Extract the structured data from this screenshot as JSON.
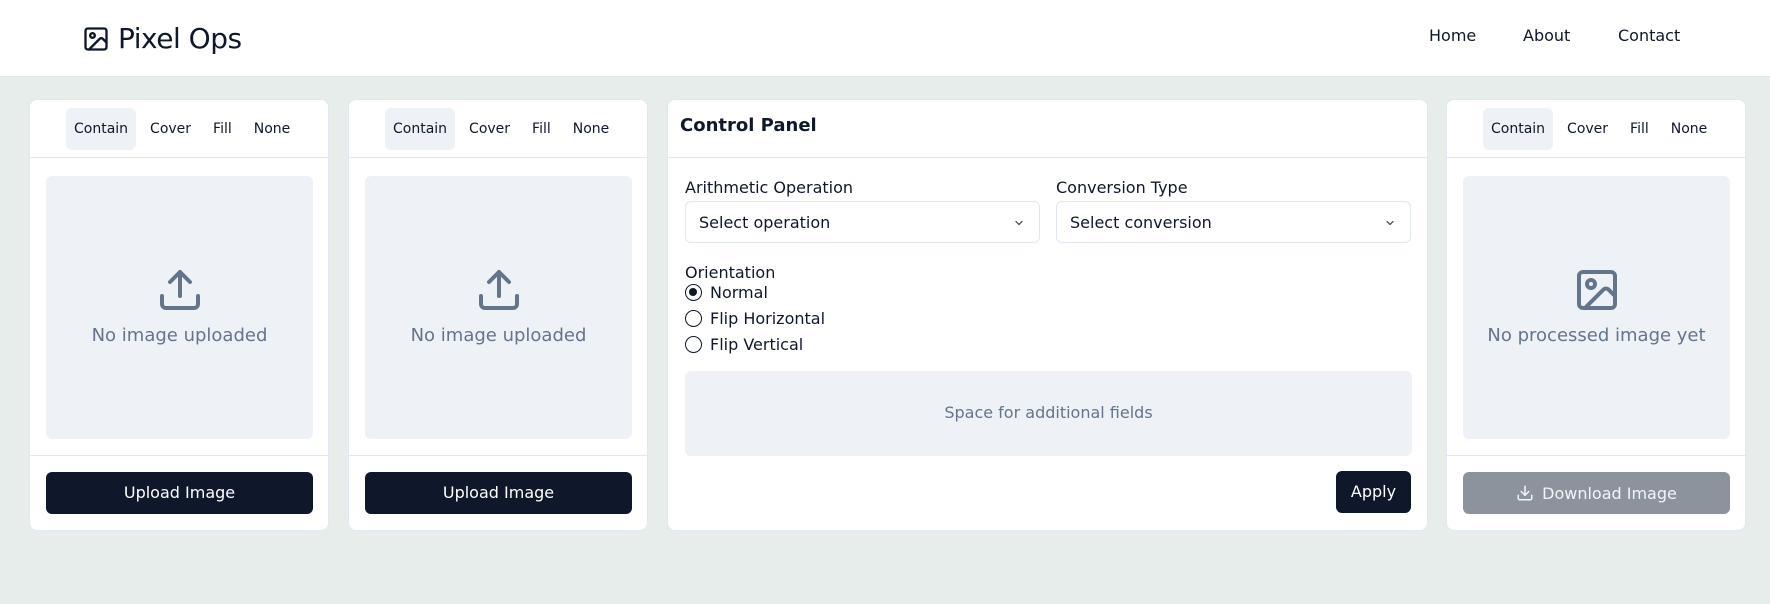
{
  "brand": {
    "name": "Pixel Ops",
    "icon": "image-icon"
  },
  "nav": {
    "links": [
      "Home",
      "About",
      "Contact"
    ]
  },
  "fit_tabs": [
    "Contain",
    "Cover",
    "Fill",
    "None"
  ],
  "input_panels": [
    {
      "active_tab": "Contain",
      "empty_text": "No image uploaded",
      "icon": "upload-icon",
      "button_label": "Upload Image"
    },
    {
      "active_tab": "Contain",
      "empty_text": "No image uploaded",
      "icon": "upload-icon",
      "button_label": "Upload Image"
    }
  ],
  "control_panel": {
    "title": "Control Panel",
    "arithmetic": {
      "label": "Arithmetic Operation",
      "value": "Select operation"
    },
    "conversion": {
      "label": "Conversion Type",
      "value": "Select conversion"
    },
    "orientation": {
      "label": "Orientation",
      "options": [
        "Normal",
        "Flip Horizontal",
        "Flip Vertical"
      ],
      "selected": "Normal"
    },
    "extra_placeholder": "Space for additional fields",
    "apply_label": "Apply"
  },
  "output_panel": {
    "active_tab": "Contain",
    "empty_text": "No processed image yet",
    "icon": "image-icon",
    "button_label": "Download Image",
    "button_icon": "download-icon",
    "button_disabled": true
  },
  "colors": {
    "primary": "#0f172a",
    "page_bg": "#e7edea",
    "placeholder_bg": "#eef2f7",
    "muted_text": "#64748b",
    "disabled_button": "#8c939d"
  }
}
